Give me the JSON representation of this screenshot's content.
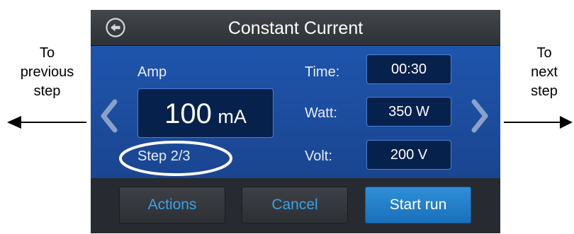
{
  "annotations": {
    "previous": "To\nprevious\nstep",
    "next": "To\nnext\nstep"
  },
  "header": {
    "title": "Constant Current",
    "back_icon": "back-arrow-circle-icon"
  },
  "main": {
    "amp_label": "Amp",
    "amp_value": "100",
    "amp_unit": "mA",
    "step_label": "Step 2/3",
    "time_label": "Time:",
    "time_value": "00:30",
    "watt_label": "Watt:",
    "watt_value": "350 W",
    "volt_label": "Volt:",
    "volt_value": "200 V"
  },
  "footer": {
    "actions_label": "Actions",
    "cancel_label": "Cancel",
    "start_label": "Start run"
  },
  "colors": {
    "screen_blue": "#1b4795",
    "box_dark": "#07214d",
    "accent_blue": "#3aa3e8",
    "primary_button": "#2585cc",
    "header_gray": "#3a3d42"
  }
}
